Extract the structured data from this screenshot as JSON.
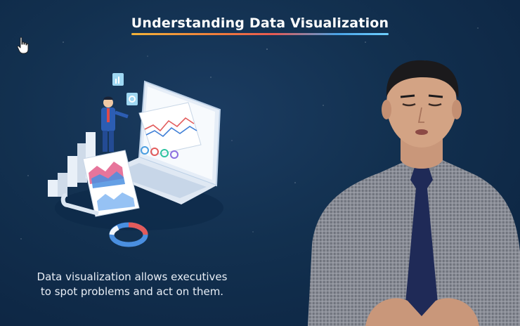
{
  "video": {
    "title": "Understanding Data Visualization",
    "caption_line1": "Data visualization allows executives",
    "caption_line2": "to spot problems and act on them."
  },
  "icons": {
    "cursor": "hand-pointer-icon",
    "illustration": "data-analytics-illustration",
    "presenter": "presenter-video"
  },
  "colors": {
    "background": "#12304f",
    "title_text": "#ffffff",
    "underline_start": "#f2b33a",
    "underline_end": "#6fd0ff"
  }
}
